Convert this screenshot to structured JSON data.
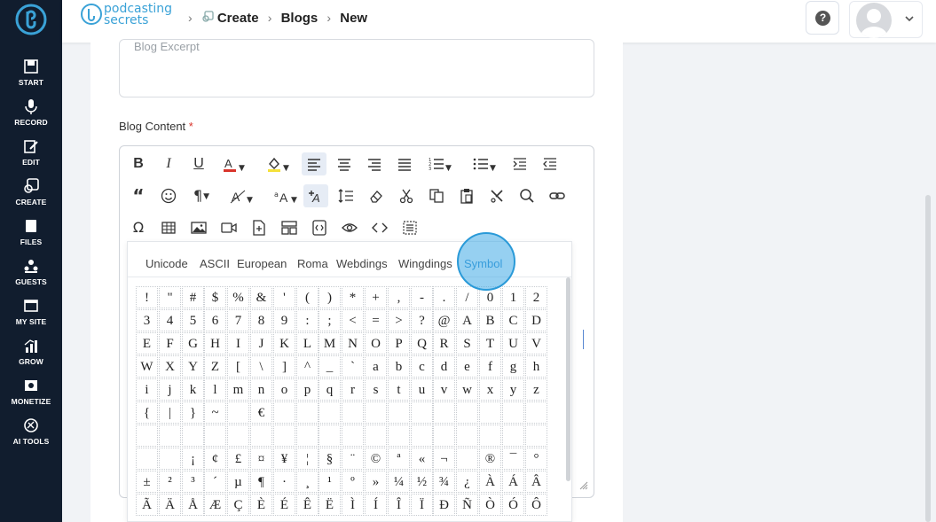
{
  "sidebar": {
    "items": [
      {
        "label": "START",
        "icon": "film-icon"
      },
      {
        "label": "RECORD",
        "icon": "mic-icon"
      },
      {
        "label": "EDIT",
        "icon": "edit-icon"
      },
      {
        "label": "CREATE",
        "icon": "create-icon"
      },
      {
        "label": "FILES",
        "icon": "files-icon"
      },
      {
        "label": "GUESTS",
        "icon": "guests-icon"
      },
      {
        "label": "MY SITE",
        "icon": "site-icon"
      },
      {
        "label": "GROW",
        "icon": "grow-icon"
      },
      {
        "label": "MONETIZE",
        "icon": "monetize-icon"
      },
      {
        "label": "AI TOOLS",
        "icon": "ai-icon"
      }
    ]
  },
  "header": {
    "brand_line1": "podcasting",
    "brand_line2": "secrets",
    "breadcrumb": [
      "Create",
      "Blogs",
      "New"
    ],
    "help_label": "?"
  },
  "form": {
    "excerpt_placeholder": "Blog Excerpt",
    "content_label": "Blog Content",
    "required_mark": "*"
  },
  "special_chars": {
    "tabs": [
      "Unicode",
      "ASCII",
      "European",
      "Roma",
      "Webdings",
      "Wingdings",
      "Symbol"
    ],
    "active_tab": "Symbol",
    "rows": [
      [
        "!",
        "\"",
        "#",
        "$",
        "%",
        "&",
        "'",
        "(",
        ")",
        "*",
        "+",
        ",",
        "-",
        ".",
        "/",
        "0",
        "1",
        "2"
      ],
      [
        "3",
        "4",
        "5",
        "6",
        "7",
        "8",
        "9",
        ":",
        ";",
        "<",
        "=",
        ">",
        "?",
        "@",
        "A",
        "B",
        "C",
        "D"
      ],
      [
        "E",
        "F",
        "G",
        "H",
        "I",
        "J",
        "K",
        "L",
        "M",
        "N",
        "O",
        "P",
        "Q",
        "R",
        "S",
        "T",
        "U",
        "V"
      ],
      [
        "W",
        "X",
        "Y",
        "Z",
        "[",
        "\\",
        "]",
        "^",
        "_",
        "`",
        "a",
        "b",
        "c",
        "d",
        "e",
        "f",
        "g",
        "h"
      ],
      [
        "i",
        "j",
        "k",
        "l",
        "m",
        "n",
        "o",
        "p",
        "q",
        "r",
        "s",
        "t",
        "u",
        "v",
        "w",
        "x",
        "y",
        "z"
      ],
      [
        "{",
        "|",
        "}",
        "~",
        "",
        "€",
        "",
        "",
        "",
        "",
        "",
        "",
        "",
        "",
        "",
        "",
        "",
        ""
      ],
      [
        "",
        "",
        "",
        "",
        "",
        "",
        "",
        "",
        "",
        "",
        "",
        "",
        "",
        "",
        "",
        "",
        "",
        ""
      ],
      [
        "",
        "",
        "¡",
        "¢",
        "£",
        "¤",
        "¥",
        "¦",
        "§",
        "¨",
        "©",
        "ª",
        "«",
        "¬",
        "",
        "®",
        "¯",
        "°"
      ],
      [
        "±",
        "²",
        "³",
        "´",
        "µ",
        "¶",
        "·",
        "¸",
        "¹",
        "º",
        "»",
        "¼",
        "½",
        "¾",
        "¿",
        "À",
        "Á",
        "Â"
      ],
      [
        "Ã",
        "Ä",
        "Å",
        "Æ",
        "Ç",
        "È",
        "É",
        "Ê",
        "Ë",
        "Ì",
        "Í",
        "Î",
        "Ï",
        "Ð",
        "Ñ",
        "Ò",
        "Ó",
        "Ô"
      ]
    ]
  },
  "colors": {
    "sidebar_bg": "#111d2e",
    "accent": "#2f8fd0",
    "required": "#d9342b"
  }
}
